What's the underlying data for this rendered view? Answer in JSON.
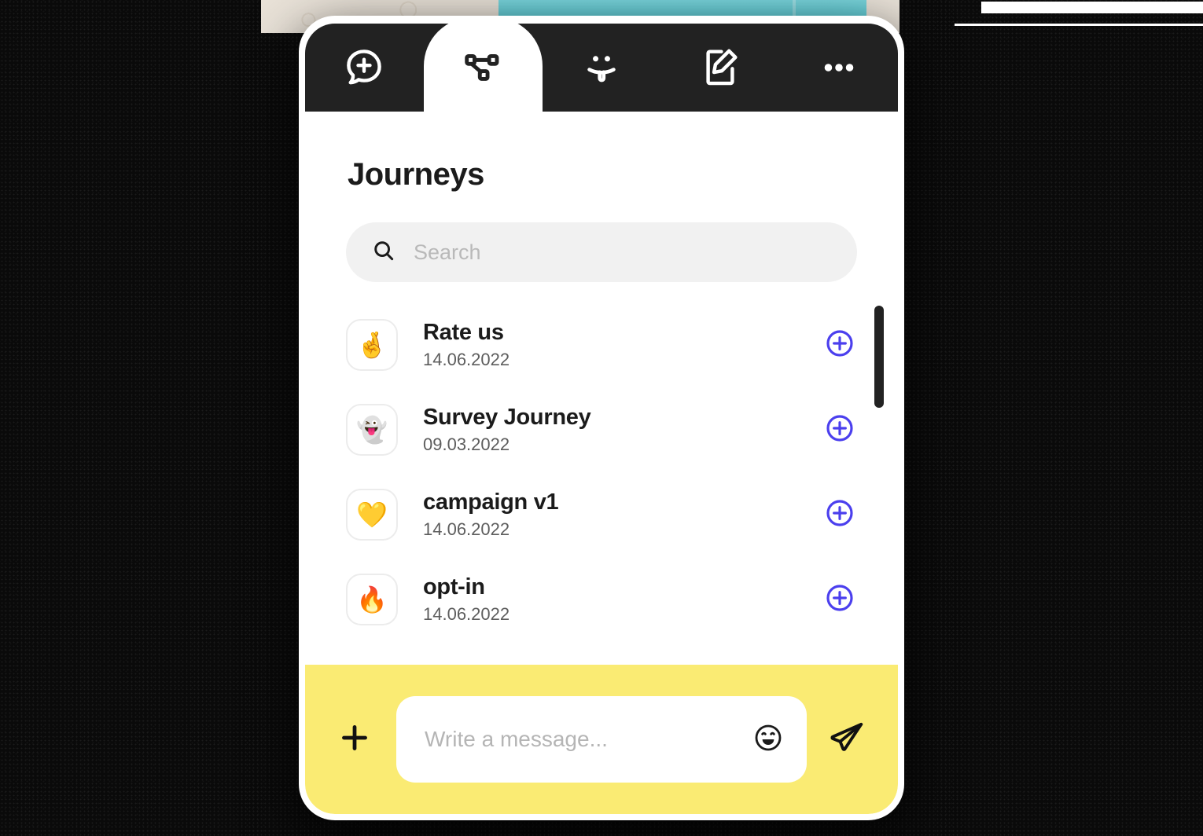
{
  "colors": {
    "tabbar_bg": "#222222",
    "accent_blue": "#4B3FEE",
    "composer_yellow": "#FAEB73",
    "search_bg": "#F1F1F1",
    "backdrop": "#0A0A0A"
  },
  "tabbar": {
    "tabs": [
      {
        "icon": "chat-plus-icon",
        "label": "New chat",
        "active": false
      },
      {
        "icon": "journeys-icon",
        "label": "Journeys",
        "active": true
      },
      {
        "icon": "sticker-face-icon",
        "label": "Stickers",
        "active": false
      },
      {
        "icon": "compose-icon",
        "label": "Compose",
        "active": false
      },
      {
        "icon": "more-dots-icon",
        "label": "More",
        "active": false
      }
    ]
  },
  "header": {
    "title": "Journeys"
  },
  "search": {
    "icon": "search-icon",
    "value": "",
    "placeholder": "Search"
  },
  "journeys": {
    "add_icon": "plus-circle-icon",
    "items": [
      {
        "emoji": "🤞",
        "emoji_name": "crossed-fingers-emoji",
        "name": "Rate us",
        "date": "14.06.2022"
      },
      {
        "emoji": "👻",
        "emoji_name": "ghost-emoji",
        "name": "Survey Journey",
        "date": "09.03.2022"
      },
      {
        "emoji": "💛",
        "emoji_name": "yellow-heart-emoji",
        "name": "campaign v1",
        "date": "14.06.2022"
      },
      {
        "emoji": "🔥",
        "emoji_name": "fire-emoji",
        "name": "opt-in",
        "date": "14.06.2022"
      }
    ]
  },
  "composer": {
    "add_icon": "plus-icon",
    "value": "",
    "placeholder": "Write a message...",
    "emoji_icon": "smiley-face-icon",
    "send_icon": "paper-plane-icon"
  }
}
